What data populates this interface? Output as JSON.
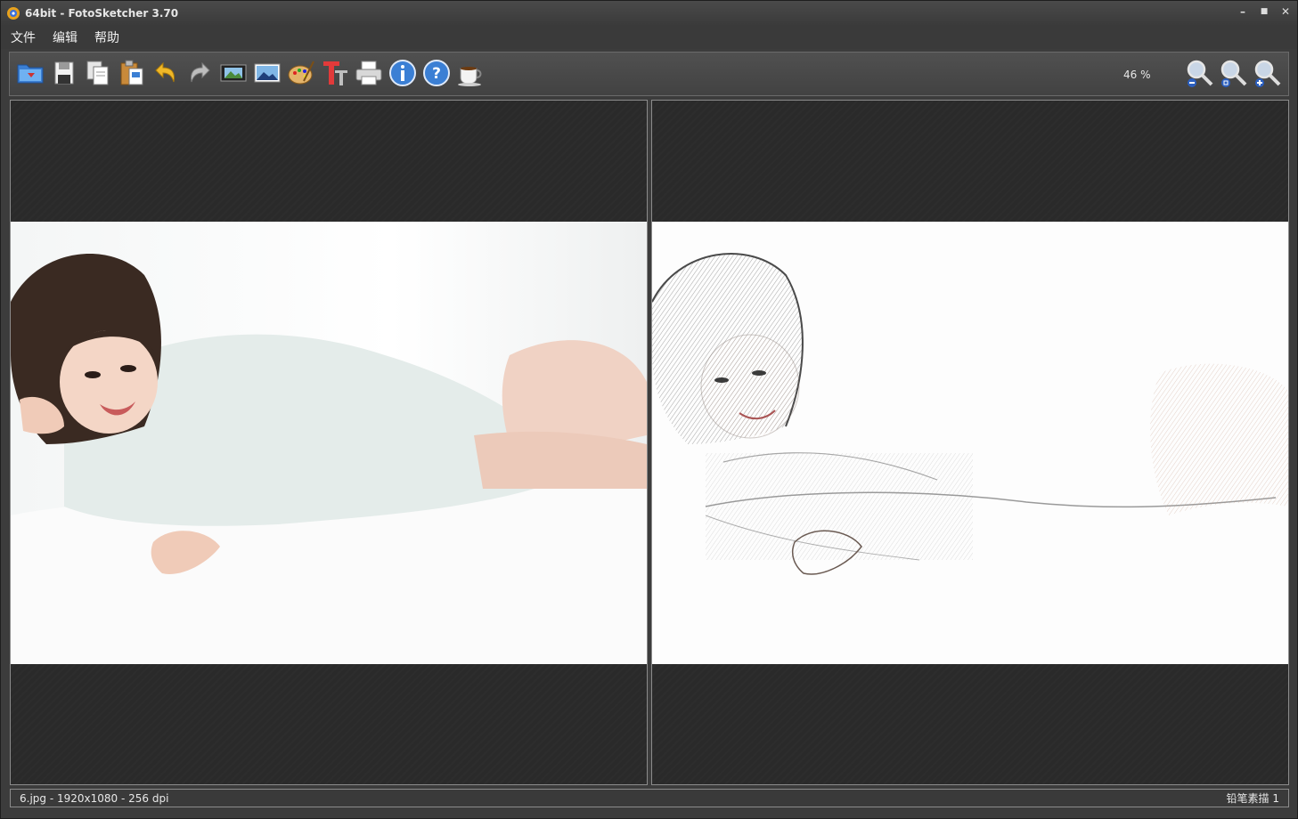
{
  "window": {
    "title": "64bit - FotoSketcher 3.70",
    "minimize_label": "–",
    "maximize_label": "■",
    "close_label": "✕"
  },
  "menu": {
    "items": [
      {
        "label": "文件"
      },
      {
        "label": "编辑"
      },
      {
        "label": "帮助"
      }
    ]
  },
  "toolbar": {
    "zoom_level": "46 %",
    "icons": [
      "open-folder-icon",
      "save-floppy-icon",
      "copy-icon",
      "paste-icon",
      "undo-icon",
      "redo-icon",
      "film-strip-icon",
      "landscape-image-icon",
      "palette-icon",
      "text-icon",
      "print-icon",
      "info-icon",
      "help-icon",
      "coffee-icon",
      "zoom-out-icon",
      "zoom-reset-icon",
      "zoom-in-icon"
    ]
  },
  "status": {
    "file_info": "6.jpg - 1920x1080 - 256 dpi",
    "effect": "铅笔素描 1"
  },
  "colors": {
    "background": "#3c3c3c",
    "pane_background": "#2a2a2a",
    "text": "#e8e8e8"
  }
}
